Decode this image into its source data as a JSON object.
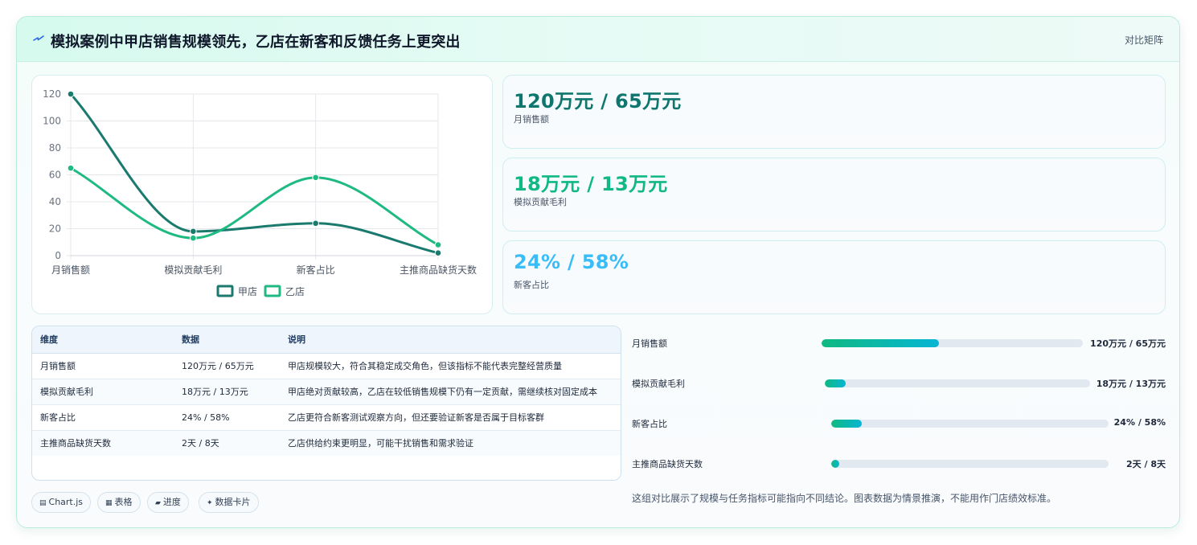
{
  "header": {
    "title": "模拟案例中甲店销售规模领先，乙店在新客和反馈任务上更突出",
    "tag": "对比矩阵"
  },
  "chart_data": {
    "type": "line",
    "categories": [
      "月销售额",
      "模拟贡献毛利",
      "新客占比",
      "主推商品缺货天数"
    ],
    "series": [
      {
        "name": "甲店",
        "values": [
          120,
          18,
          24,
          2
        ],
        "color": "#1a7a6e"
      },
      {
        "name": "乙店",
        "values": [
          65,
          13,
          58,
          8
        ],
        "color": "#1fba82"
      }
    ],
    "ylim": [
      0,
      120
    ],
    "yticks": [
      0,
      20,
      40,
      60,
      80,
      100,
      120
    ],
    "legend_position": "bottom",
    "grid": true,
    "smooth": true
  },
  "kpis": [
    {
      "value": "120万元 / 65万元",
      "label": "月销售额",
      "color": "#0f766e"
    },
    {
      "value": "18万元 / 13万元",
      "label": "模拟贡献毛利",
      "color": "#10b981"
    },
    {
      "value": "24% / 58%",
      "label": "新客占比",
      "color": "#38bdf8"
    }
  ],
  "table": {
    "headers": [
      "维度",
      "数据",
      "说明"
    ],
    "rows": [
      [
        "月销售额",
        "120万元 / 65万元",
        "甲店规模较大，符合其稳定成交角色，但该指标不能代表完整经营质量"
      ],
      [
        "模拟贡献毛利",
        "18万元 / 13万元",
        "甲店绝对贡献较高，乙店在较低销售规模下仍有一定贡献，需继续核对固定成本"
      ],
      [
        "新客占比",
        "24% / 58%",
        "乙店更符合新客测试观察方向，但还要验证新客是否属于目标客群"
      ],
      [
        "主推商品缺货天数",
        "2天 / 8天",
        "乙店供给约束更明显，可能干扰销售和需求验证"
      ]
    ]
  },
  "progress": [
    {
      "label": "月销售额",
      "value": "120万元 / 65万元",
      "fraction": 0.45
    },
    {
      "label": "模拟贡献毛利",
      "value": "18万元 / 13万元",
      "fraction": 0.08
    },
    {
      "label": "新客占比",
      "value": "24% / 58%",
      "fraction": 0.11
    },
    {
      "label": "主推商品缺货天数",
      "value": "2天 / 8天",
      "fraction": 0.03
    }
  ],
  "pills": [
    {
      "icon": "▤",
      "label": "Chart.js",
      "icon_name": "chart-icon"
    },
    {
      "icon": "▦",
      "label": "表格",
      "icon_name": "table-icon"
    },
    {
      "icon": "▰",
      "label": "进度",
      "icon_name": "progress-icon"
    },
    {
      "icon": "✦",
      "label": "数据卡片",
      "icon_name": "sparkle-icon"
    }
  ],
  "note": "这组对比展示了规模与任务指标可能指向不同结论。图表数据为情景推演，不能用作门店绩效标准。"
}
